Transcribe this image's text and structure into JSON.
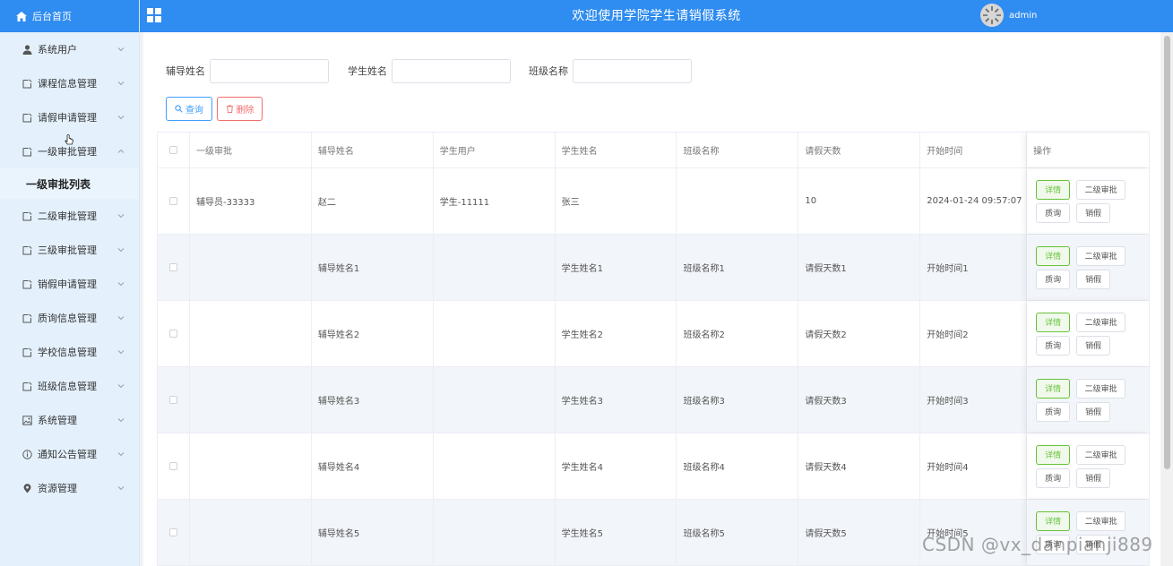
{
  "sidebar": {
    "home_label": "后台首页",
    "items": [
      {
        "label": "系统用户",
        "icon": "user-icon"
      },
      {
        "label": "课程信息管理",
        "icon": "document-icon"
      },
      {
        "label": "请假申请管理",
        "icon": "document-icon"
      },
      {
        "label": "一级审批管理",
        "icon": "document-icon",
        "expanded": true
      },
      {
        "label": "二级审批管理",
        "icon": "document-icon"
      },
      {
        "label": "三级审批管理",
        "icon": "document-icon"
      },
      {
        "label": "销假申请管理",
        "icon": "document-icon"
      },
      {
        "label": "质询信息管理",
        "icon": "document-icon"
      },
      {
        "label": "学校信息管理",
        "icon": "document-icon"
      },
      {
        "label": "班级信息管理",
        "icon": "document-icon"
      },
      {
        "label": "系统管理",
        "icon": "image-icon"
      },
      {
        "label": "通知公告管理",
        "icon": "info-icon"
      },
      {
        "label": "资源管理",
        "icon": "location-icon"
      }
    ],
    "submenu_active": "一级审批列表"
  },
  "header": {
    "title": "欢迎使用学院学生请销假系统",
    "username": "admin"
  },
  "search": {
    "fields": [
      {
        "label": "辅导姓名",
        "placeholder": ""
      },
      {
        "label": "学生姓名",
        "placeholder": ""
      },
      {
        "label": "班级名称",
        "placeholder": ""
      }
    ],
    "search_button": "查询",
    "delete_button": "删除"
  },
  "table": {
    "columns": [
      "一级审批",
      "辅导姓名",
      "学生用户",
      "学生姓名",
      "班级名称",
      "请假天数",
      "开始时间",
      "操作"
    ],
    "rows": [
      [
        "辅导员-33333",
        "赵二",
        "学生-11111",
        "张三",
        "",
        "10",
        "2024-01-24 09:57:07"
      ],
      [
        "",
        "辅导姓名1",
        "",
        "学生姓名1",
        "班级名称1",
        "请假天数1",
        "开始时间1"
      ],
      [
        "",
        "辅导姓名2",
        "",
        "学生姓名2",
        "班级名称2",
        "请假天数2",
        "开始时间2"
      ],
      [
        "",
        "辅导姓名3",
        "",
        "学生姓名3",
        "班级名称3",
        "请假天数3",
        "开始时间3"
      ],
      [
        "",
        "辅导姓名4",
        "",
        "学生姓名4",
        "班级名称4",
        "请假天数4",
        "开始时间4"
      ],
      [
        "",
        "辅导姓名5",
        "",
        "学生姓名5",
        "班级名称5",
        "请假天数5",
        "开始时间5"
      ]
    ],
    "row_actions": {
      "detail": "详情",
      "level2": "二级审批",
      "query": "质询",
      "cancel": "销假"
    }
  },
  "watermark": "CSDN @vx_danpianji889",
  "colors": {
    "primary": "#2f8cf0",
    "sidebar_bg": "#e4f1fd",
    "success": "#67c23a",
    "danger": "#f56c6c"
  }
}
